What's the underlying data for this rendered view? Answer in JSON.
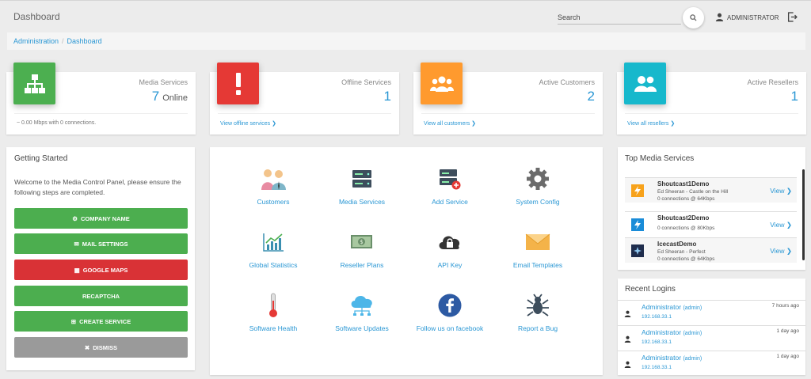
{
  "header": {
    "title": "Dashboard",
    "search_label": "Search",
    "user_name": "ADMINISTRATOR"
  },
  "breadcrumb": [
    "Administration",
    "Dashboard"
  ],
  "stats": [
    {
      "label": "Media Services",
      "value": "7",
      "suffix": "Online",
      "footer": "~ 0.00 Mbps with 0 connections.",
      "color": "#4caf50",
      "icon": "sitemap-icon"
    },
    {
      "label": "Offline Services",
      "value": "1",
      "footer": "View offline services",
      "color": "#e53935",
      "icon": "exclamation-icon"
    },
    {
      "label": "Active Customers",
      "value": "2",
      "footer": "View all customers",
      "color": "#ff9a2e",
      "icon": "users-icon"
    },
    {
      "label": "Active Resellers",
      "value": "1",
      "footer": "View all resellers",
      "color": "#17b8cc",
      "icon": "user-group-icon"
    }
  ],
  "getting_started": {
    "title": "Getting Started",
    "text": "Welcome to the Media Control Panel, please ensure the following steps are completed.",
    "buttons": [
      "COMPANY NAME",
      "MAIL SETTINGS",
      "GOOGLE MAPS",
      "RECAPTCHA",
      "CREATE SERVICE",
      "DISMISS"
    ]
  },
  "shortcuts": [
    "Customers",
    "Media Services",
    "Add Service",
    "System Config",
    "Global Statistics",
    "Reseller Plans",
    "API Key",
    "Email Templates",
    "Software Health",
    "Software Updates",
    "Follow us on facebook",
    "Report a Bug"
  ],
  "top_media": {
    "title": "Top Media Services",
    "view_label": "View",
    "items": [
      {
        "name": "Shoutcast1Demo",
        "song": "Ed Sheeran - Castle on the Hill",
        "connections": "0 connections @ 64Kbps"
      },
      {
        "name": "Shoutcast2Demo",
        "song": "",
        "connections": "0 connections @ 80Kbps"
      },
      {
        "name": "IcecastDemo",
        "song": "Ed Sheeran - Perfect",
        "connections": "0 connections @ 64Kbps"
      }
    ]
  },
  "recent_logins": {
    "title": "Recent Logins",
    "items": [
      {
        "user": "Administrator",
        "role": "(admin)",
        "ip": "192.168.33.1",
        "time": "7 hours ago"
      },
      {
        "user": "Administrator",
        "role": "(admin)",
        "ip": "192.168.33.1",
        "time": "1 day ago"
      },
      {
        "user": "Administrator",
        "role": "(admin)",
        "ip": "192.168.33.1",
        "time": "1 day ago"
      }
    ]
  }
}
